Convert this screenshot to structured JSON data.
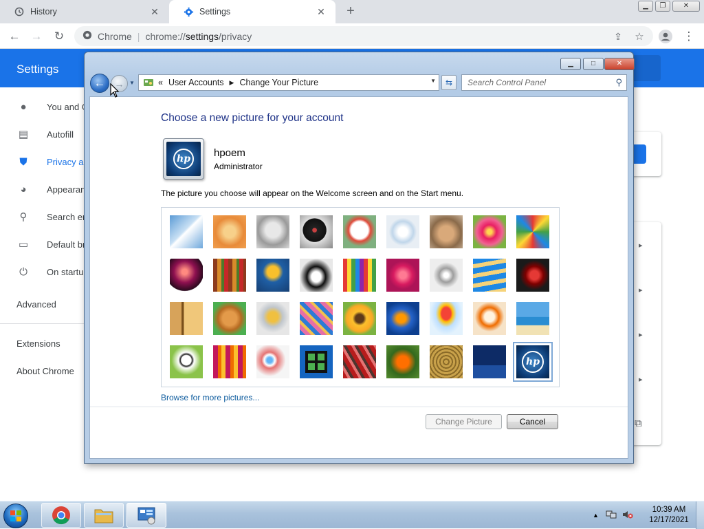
{
  "browser": {
    "tabs": [
      {
        "label": "History",
        "icon": "history-icon"
      },
      {
        "label": "Settings",
        "icon": "gear-icon"
      }
    ],
    "site_label": "Chrome",
    "url_scheme": "chrome://",
    "url_host": "settings",
    "url_path": "/privacy"
  },
  "settings": {
    "title": "Settings",
    "sidebar": [
      {
        "label": "You and Google",
        "icon": "person-icon"
      },
      {
        "label": "Autofill",
        "icon": "clipboard-icon"
      },
      {
        "label": "Privacy and security",
        "icon": "shield-icon"
      },
      {
        "label": "Appearance",
        "icon": "palette-icon"
      },
      {
        "label": "Search engine",
        "icon": "search-icon"
      },
      {
        "label": "Default browser",
        "icon": "browser-icon"
      },
      {
        "label": "On startup",
        "icon": "power-icon"
      }
    ],
    "advanced": "Advanced",
    "extensions": "Extensions",
    "about": "About Chrome"
  },
  "dialog": {
    "breadcrumb": [
      "User Accounts",
      "Change Your Picture"
    ],
    "search_placeholder": "Search Control Panel",
    "heading": "Choose a new picture for your account",
    "user_name": "hpoem",
    "user_role": "Administrator",
    "description": "The picture you choose will appear on the Welcome screen and on the Start menu.",
    "browse_link": "Browse for more pictures...",
    "change_button": "Change Picture",
    "cancel_button": "Cancel",
    "pictures": [
      "roller-coaster",
      "starfish",
      "robot-toy",
      "record-player",
      "lucky-cat",
      "gyroscope",
      "kitten",
      "flower",
      "pinwheel",
      "ball",
      "fabric",
      "leaf",
      "dog",
      "crayons",
      "star-lantern",
      "jacks",
      "stairs",
      "origami-crane",
      "guitar",
      "puppy",
      "tin-robot",
      "scarf",
      "sunflower",
      "fish",
      "hot-air-balloon",
      "doll",
      "sailboat",
      "soccer-ball",
      "fabric-stripes",
      "marbles",
      "window-frame",
      "woven-fabric",
      "butterfly",
      "basket",
      "lighthouse",
      "hp-logo"
    ],
    "selected_picture_index": 35
  },
  "taskbar": {
    "time": "10:39 AM",
    "date": "12/17/2021",
    "buttons": [
      "chrome-icon",
      "folder-icon",
      "control-panel-icon"
    ]
  },
  "colors": {
    "chrome_blue": "#1a73e8",
    "dialog_heading": "#1e3287",
    "link": "#0e5c9e"
  }
}
